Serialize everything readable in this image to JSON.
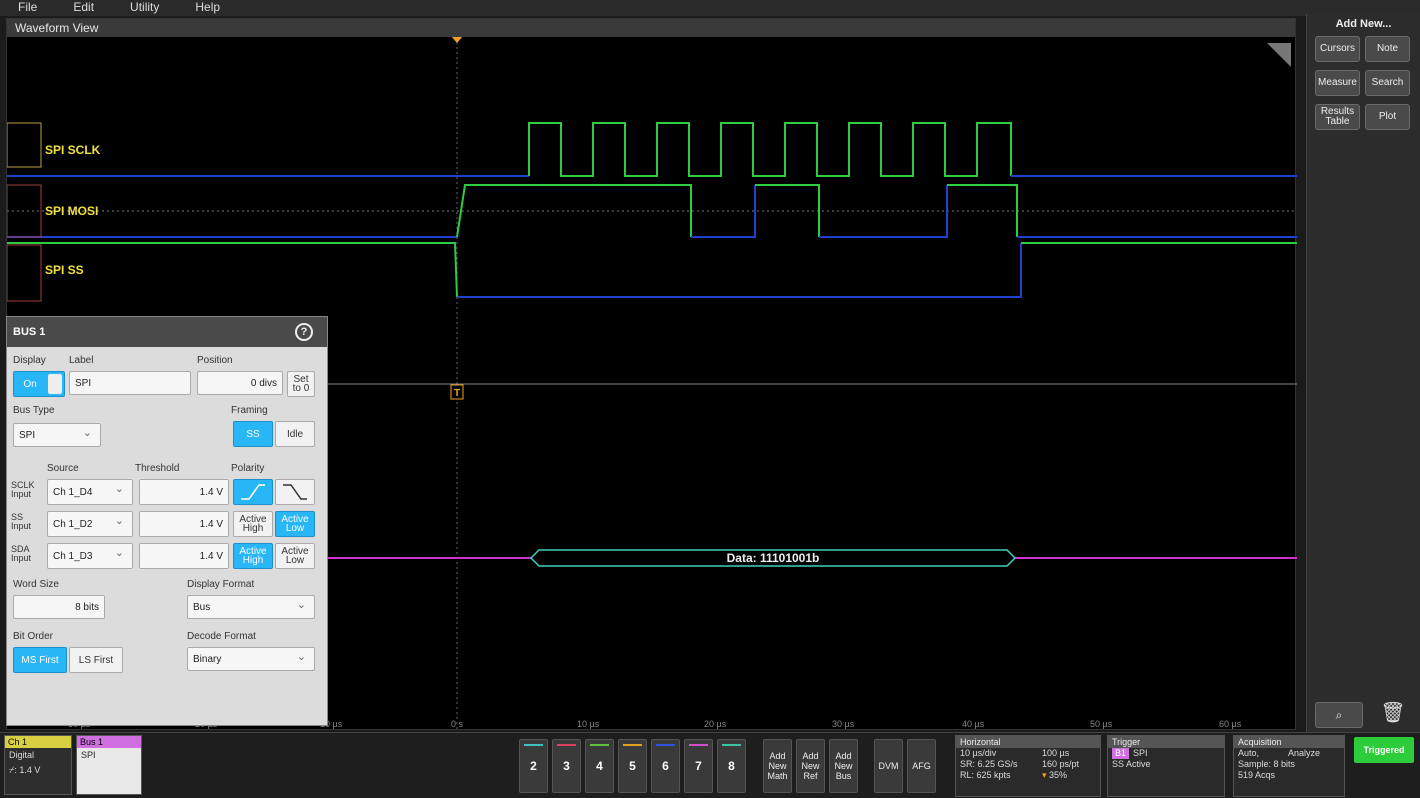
{
  "menu": [
    "File",
    "Edit",
    "Utility",
    "Help"
  ],
  "waveform": {
    "title": "Waveform View",
    "channels": [
      {
        "name": "SPI SCLK",
        "color": "#f0e040"
      },
      {
        "name": "SPI MOSI",
        "color": "#f0e040"
      },
      {
        "name": "SPI SS",
        "color": "#f0e040"
      }
    ],
    "decode_label": "Data: 11101001b",
    "time_labels": [
      "-30 µs",
      "-20 µs",
      "-10 µs",
      "0 s",
      "10 µs",
      "20 µs",
      "30 µs",
      "40 µs",
      "50 µs",
      "60 µs"
    ],
    "trigger_marker": "T",
    "colors": {
      "trace_high": "#2ecc40",
      "trace_low": "#2040d0",
      "bus": "#d030d0",
      "decode_border": "#40d0c0",
      "cursor_orange": "#f0a020"
    }
  },
  "sidebar": {
    "title": "Add New...",
    "buttons": [
      "Cursors",
      "Note",
      "Measure",
      "Search",
      "Results Table",
      "Plot"
    ]
  },
  "panel": {
    "title": "BUS 1",
    "display_label": "Display",
    "display_value": "On",
    "label_label": "Label",
    "label_value": "SPI",
    "position_label": "Position",
    "position_value": "0 divs",
    "set_to_0": "Set to 0",
    "bus_type_label": "Bus Type",
    "bus_type_value": "SPI",
    "framing_label": "Framing",
    "framing_options": [
      "SS",
      "Idle"
    ],
    "source_label": "Source",
    "threshold_label": "Threshold",
    "polarity_label": "Polarity",
    "rows": [
      {
        "name": "SCLK Input",
        "source": "Ch 1_D4",
        "threshold": "1.4 V"
      },
      {
        "name": "SS Input",
        "source": "Ch 1_D2",
        "threshold": "1.4 V",
        "pol": [
          "Active High",
          "Active Low"
        ]
      },
      {
        "name": "SDA Input",
        "source": "Ch 1_D3",
        "threshold": "1.4 V",
        "pol": [
          "Active High",
          "Active Low"
        ]
      }
    ],
    "word_size_label": "Word Size",
    "word_size_value": "8 bits",
    "display_format_label": "Display Format",
    "display_format_value": "Bus",
    "bit_order_label": "Bit Order",
    "bit_order_options": [
      "MS First",
      "LS First"
    ],
    "decode_format_label": "Decode Format",
    "decode_format_value": "Binary"
  },
  "bottom": {
    "ch1": {
      "head": "Ch 1",
      "lines": [
        "Digital",
        "⌿: 1.4 V"
      ]
    },
    "bus1": {
      "head": "Bus 1",
      "lines": [
        "SPI"
      ]
    },
    "channel_buttons": [
      "2",
      "3",
      "4",
      "5",
      "6",
      "7",
      "8"
    ],
    "channel_colors": [
      "#40c0c0",
      "#e04060",
      "#60c040",
      "#e0a020",
      "#3050e0",
      "#d050d0",
      "#40c0a0"
    ],
    "add_buttons": [
      "Add New Math",
      "Add New Ref",
      "Add New Bus"
    ],
    "dvm": "DVM",
    "afg": "AFG",
    "horizontal": {
      "head": "Horizontal",
      "r1a": "10 µs/div",
      "r1b": "100 µs",
      "r2a": "SR: 6.25 GS/s",
      "r2b": "160 ps/pt",
      "r3a": "RL: 625 kpts",
      "r3b": "35%"
    },
    "trigger": {
      "head": "Trigger",
      "badge": "B1",
      "src": "SPI",
      "cond": "SS Active"
    },
    "acquisition": {
      "head": "Acquisition",
      "r1a": "Auto,",
      "r1b": "Analyze",
      "r2": "Sample: 8 bits",
      "r3": "519 Acqs"
    },
    "triggered": "Triggered"
  }
}
